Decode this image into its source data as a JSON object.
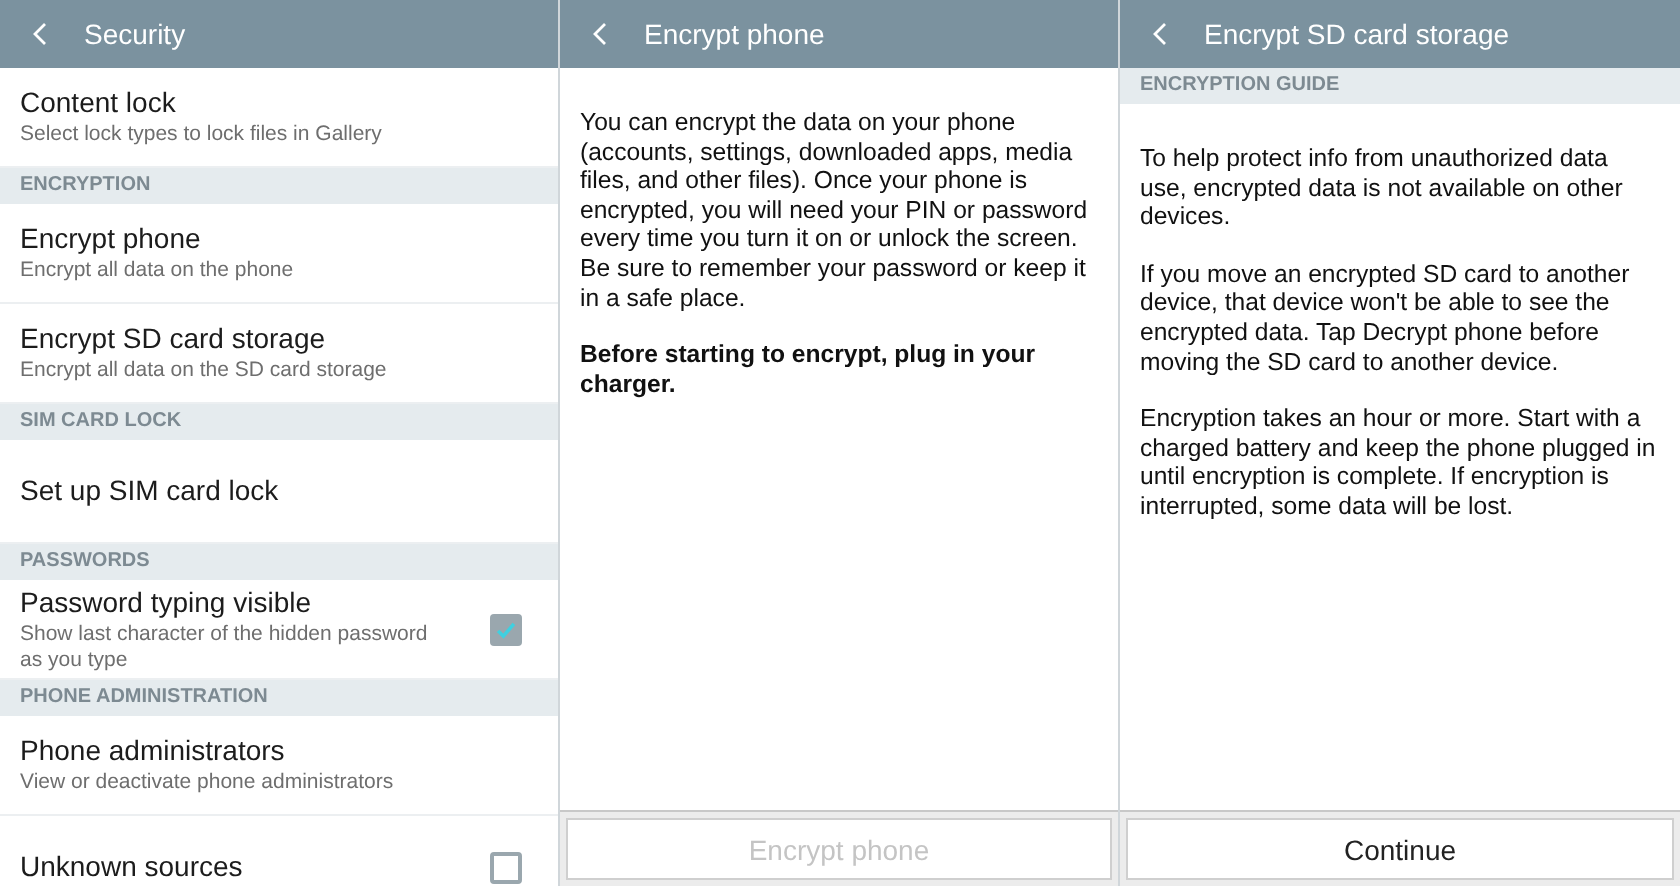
{
  "screens": [
    {
      "title": "Security",
      "kind": "list",
      "items": [
        {
          "kind": "item",
          "title": "Content lock",
          "subtitle": "Select lock types to lock files in Gallery"
        },
        {
          "kind": "header",
          "title": "ENCRYPTION"
        },
        {
          "kind": "item",
          "title": "Encrypt phone",
          "subtitle": "Encrypt all data on the phone"
        },
        {
          "kind": "item",
          "title": "Encrypt SD card storage",
          "subtitle": "Encrypt all data on the SD card storage"
        },
        {
          "kind": "header",
          "title": "SIM CARD LOCK"
        },
        {
          "kind": "item",
          "title": "Set up SIM card lock"
        },
        {
          "kind": "header",
          "title": "PASSWORDS"
        },
        {
          "kind": "check",
          "title": "Password typing visible",
          "subtitle": "Show last character of the hidden password as you type",
          "checked": true
        },
        {
          "kind": "header",
          "title": "PHONE ADMINISTRATION"
        },
        {
          "kind": "item",
          "title": "Phone administrators",
          "subtitle": "View or deactivate phone administrators"
        },
        {
          "kind": "check",
          "title": "Unknown sources",
          "checked": false
        }
      ]
    },
    {
      "title": "Encrypt phone",
      "kind": "text",
      "paragraphs": [
        {
          "text": "You can encrypt the data on your phone (accounts, settings, downloaded apps, media files, and other files). Once your phone is encrypted, you will need your PIN or password every time you turn it on or unlock the screen. Be sure to remember your password or keep it in a safe place.",
          "bold": false
        },
        {
          "text": "Before starting to encrypt, plug in your charger.",
          "bold": true
        }
      ],
      "button": {
        "label": "Encrypt phone",
        "disabled": true
      }
    },
    {
      "title": "Encrypt SD card storage",
      "kind": "text",
      "section": "ENCRYPTION GUIDE",
      "paragraphs": [
        {
          "text": "To help protect info from unauthorized data use, encrypted data is not available on other devices.",
          "bold": false
        },
        {
          "text": "If you move an encrypted SD card to another device, that device won't be able to see the encrypted data. Tap Decrypt phone before moving the SD card to another device.",
          "bold": false
        },
        {
          "text": "Encryption takes an hour or more. Start with a charged battery and keep the phone plugged in until encryption is complete. If encryption is interrupted, some data will be lost.",
          "bold": false
        }
      ],
      "button": {
        "label": "Continue",
        "disabled": false
      }
    }
  ]
}
